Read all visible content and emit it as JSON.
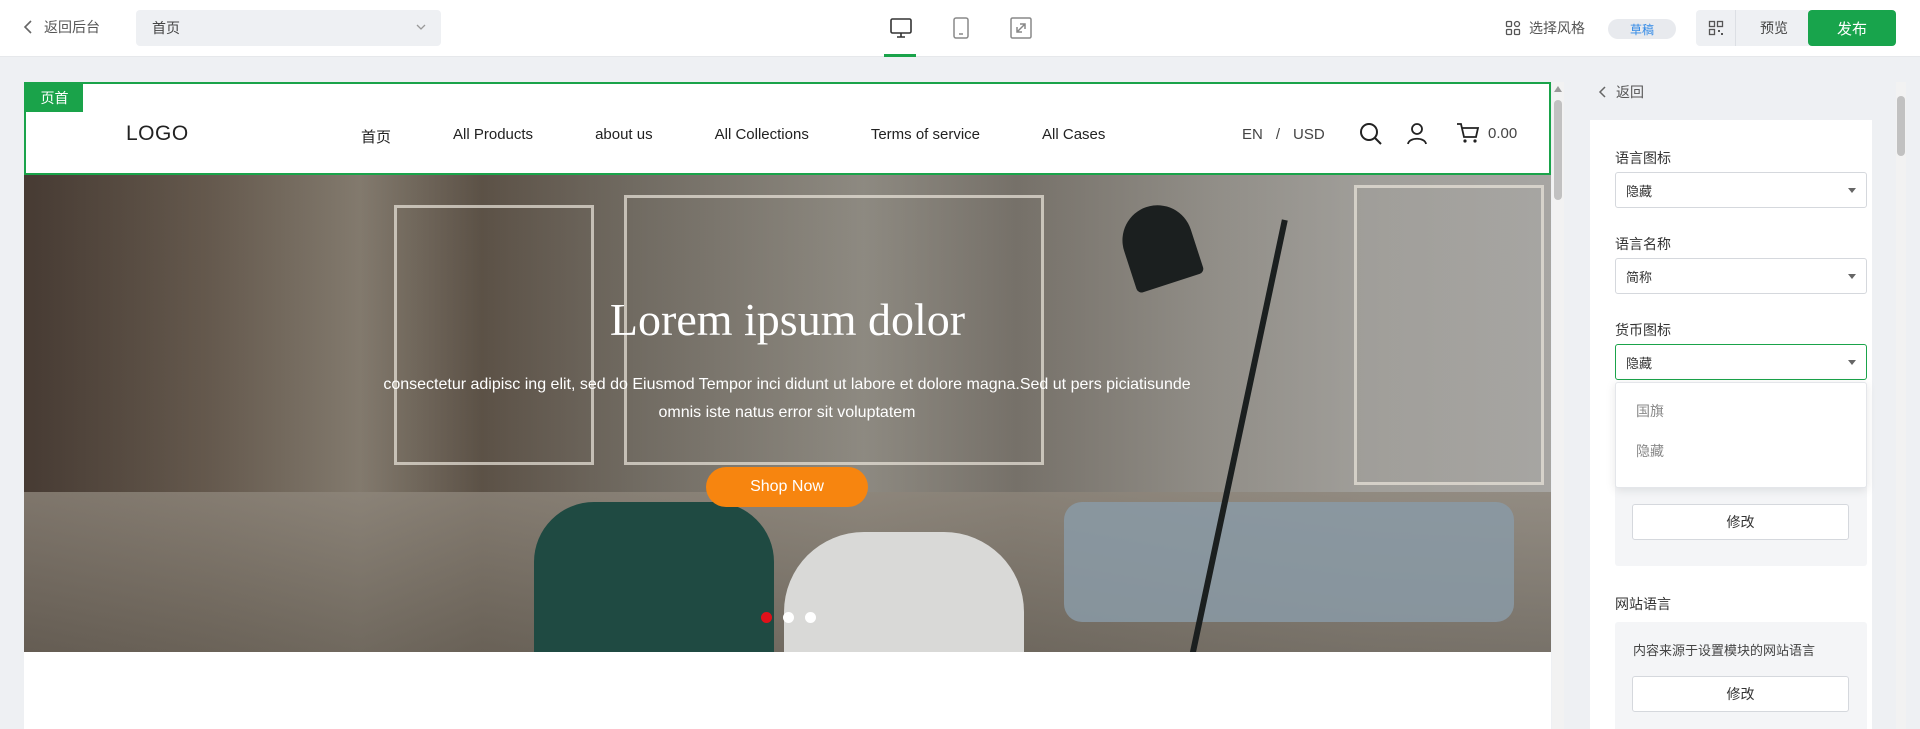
{
  "topbar": {
    "back_label": "返回后台",
    "page_select": "首页",
    "style_label": "选择风格",
    "draft_badge": "草稿",
    "preview_label": "预览",
    "publish_label": "发布",
    "devices": [
      "desktop-icon",
      "tablet-icon",
      "fullscreen-icon"
    ]
  },
  "site": {
    "section_tag": "页首",
    "logo": "LOGO",
    "nav": [
      "首页",
      "All Products",
      "about us",
      "All Collections",
      "Terms of service",
      "All Cases"
    ],
    "lang": "EN",
    "separator": "/",
    "currency": "USD",
    "cart_amount": "0.00",
    "hero": {
      "title": "Lorem ipsum dolor",
      "subtitle": "consectetur adipisc ing elit, sed do Eiusmod Tempor inci didunt ut labore et dolore magna.Sed ut pers piciatisunde omnis iste natus error sit voluptatem",
      "cta": "Shop Now",
      "slides": 3,
      "active_slide": 1
    }
  },
  "panel": {
    "back_label": "返回",
    "lang_icon_label": "语言图标",
    "lang_icon_value": "隐藏",
    "lang_name_label": "语言名称",
    "lang_name_value": "简称",
    "currency_icon_label": "货币图标",
    "currency_icon_value": "隐藏",
    "dropdown_options": [
      "国旗",
      "隐藏"
    ],
    "modify_label": "修改",
    "site_lang_label": "网站语言",
    "site_lang_note": "内容来源于设置模块的网站语言",
    "modify_label_2": "修改"
  },
  "colors": {
    "accent": "#1aa34a",
    "cta": "#f7850f",
    "active_dot": "#e0111a",
    "draft_text": "#2f88e6"
  }
}
